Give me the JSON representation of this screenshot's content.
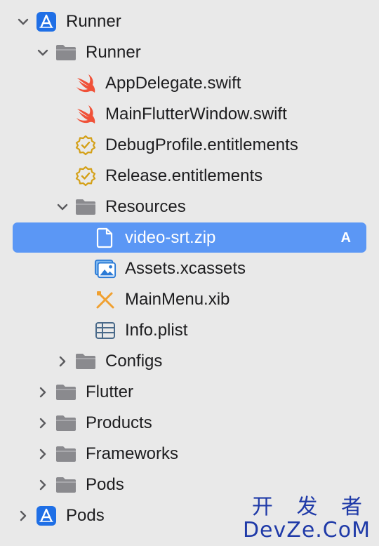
{
  "tree": [
    {
      "name": "Runner",
      "type": "project",
      "depth": 0,
      "disclosure": "expanded"
    },
    {
      "name": "Runner",
      "type": "folder",
      "depth": 1,
      "disclosure": "expanded"
    },
    {
      "name": "AppDelegate.swift",
      "type": "swift",
      "depth": 2,
      "disclosure": "none"
    },
    {
      "name": "MainFlutterWindow.swift",
      "type": "swift",
      "depth": 2,
      "disclosure": "none"
    },
    {
      "name": "DebugProfile.entitlements",
      "type": "entitlements",
      "depth": 2,
      "disclosure": "none"
    },
    {
      "name": "Release.entitlements",
      "type": "entitlements",
      "depth": 2,
      "disclosure": "none"
    },
    {
      "name": "Resources",
      "type": "folder",
      "depth": 2,
      "disclosure": "expanded"
    },
    {
      "name": "video-srt.zip",
      "type": "file",
      "depth": 3,
      "disclosure": "none",
      "selected": true,
      "status": "A"
    },
    {
      "name": "Assets.xcassets",
      "type": "assets",
      "depth": 3,
      "disclosure": "none"
    },
    {
      "name": "MainMenu.xib",
      "type": "xib",
      "depth": 3,
      "disclosure": "none"
    },
    {
      "name": "Info.plist",
      "type": "plist",
      "depth": 3,
      "disclosure": "none"
    },
    {
      "name": "Configs",
      "type": "folder",
      "depth": 2,
      "disclosure": "collapsed"
    },
    {
      "name": "Flutter",
      "type": "folder",
      "depth": 1,
      "disclosure": "collapsed"
    },
    {
      "name": "Products",
      "type": "folder",
      "depth": 1,
      "disclosure": "collapsed"
    },
    {
      "name": "Frameworks",
      "type": "folder",
      "depth": 1,
      "disclosure": "collapsed"
    },
    {
      "name": "Pods",
      "type": "folder",
      "depth": 1,
      "disclosure": "collapsed"
    },
    {
      "name": "Pods",
      "type": "project",
      "depth": 0,
      "disclosure": "collapsed"
    }
  ],
  "watermark": {
    "line1": "开 发 者",
    "line2": "DevZe.CoM"
  },
  "colors": {
    "selection": "#5b97f5",
    "swift": "#f05138",
    "entitlements": "#d4a017",
    "project": "#1f6fe6",
    "folder": "#86868b"
  }
}
